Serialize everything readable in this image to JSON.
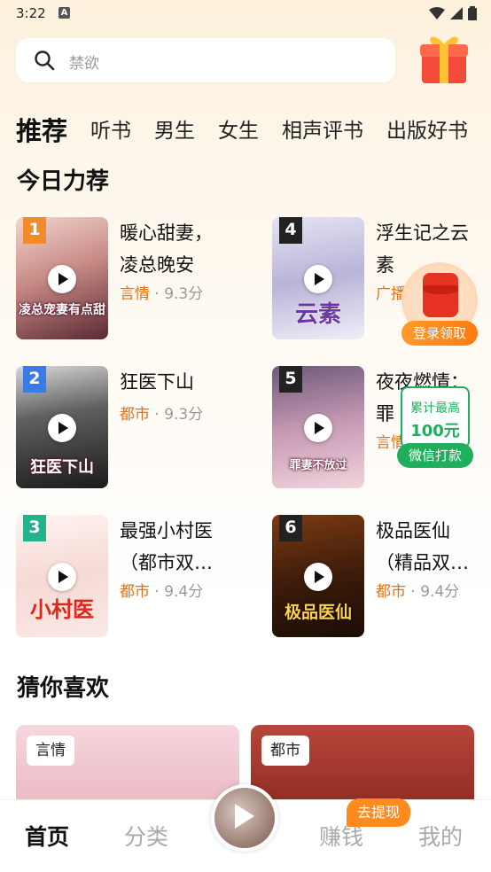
{
  "status": {
    "time": "3:22"
  },
  "search": {
    "placeholder": "禁欲"
  },
  "tabs": [
    "推荐",
    "听书",
    "男生",
    "女生",
    "相声评书",
    "出版好书"
  ],
  "today_title": "今日力荐",
  "books": [
    {
      "rank": "1",
      "title1": "暖心甜妻，",
      "title2": "凌总晚安",
      "genre": "言情",
      "score": "· 9.3分",
      "cover_text": "凌总宠妻有点甜",
      "badge_color": "#f28b2c"
    },
    {
      "rank": "2",
      "title1": "狂医下山",
      "title2": "",
      "genre": "都市",
      "score": "· 9.3分",
      "cover_text": "狂医下山",
      "badge_color": "#3a7be8"
    },
    {
      "rank": "3",
      "title1": "最强小村医",
      "title2": "（都市双…",
      "genre": "都市",
      "score": "· 9.4分",
      "cover_text": "小村医",
      "badge_color": "#23b38a"
    },
    {
      "rank": "4",
      "title1": "浮生记之云",
      "title2": "素",
      "genre": "广播",
      "score": "",
      "cover_text": "云素",
      "badge_color": "#222222"
    },
    {
      "rank": "5",
      "title1": "夜夜燃情：",
      "title2": "罪",
      "genre": "言情",
      "score": "",
      "cover_text": "罪妻不放过",
      "badge_color": "#222222"
    },
    {
      "rank": "6",
      "title1": "极品医仙",
      "title2": "（精品双…",
      "genre": "都市",
      "score": "· 9.4分",
      "cover_text": "极品医仙",
      "badge_color": "#222222"
    }
  ],
  "red_packet": {
    "label": "登录领取"
  },
  "wechat": {
    "top": "累计最高",
    "amount": "100元",
    "button": "微信打款"
  },
  "guess_title": "猜你喜欢",
  "feed": [
    {
      "tag": "言情"
    },
    {
      "tag": "都市"
    }
  ],
  "nav": {
    "home": "首页",
    "category": "分类",
    "earn": "赚钱",
    "mine": "我的",
    "badge": "去提现"
  }
}
